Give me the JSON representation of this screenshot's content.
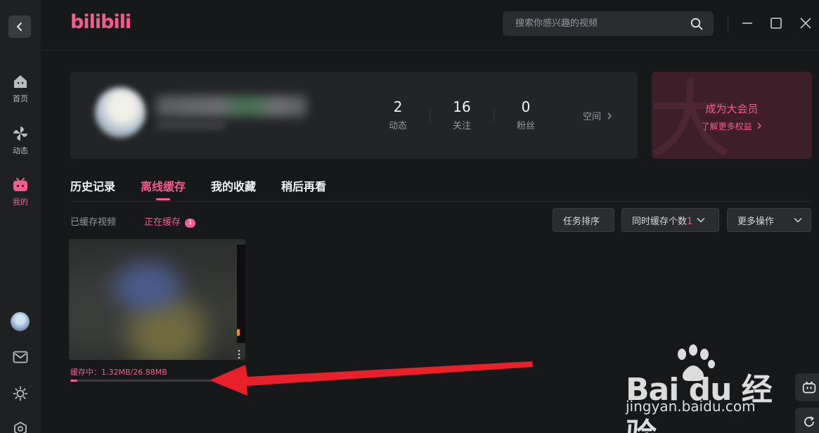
{
  "app": {
    "logo_text": "bilibili",
    "accent_color": "#f25d8e"
  },
  "search": {
    "placeholder": "搜索你感兴趣的视频"
  },
  "sidebar": {
    "items": [
      {
        "label": "首页",
        "icon": "home-icon"
      },
      {
        "label": "动态",
        "icon": "pinwheel-icon"
      },
      {
        "label": "我的",
        "icon": "tv-icon",
        "active": true
      }
    ],
    "bottom_icons": [
      "avatar",
      "mail-icon",
      "theme-sun-icon",
      "settings-icon"
    ]
  },
  "profile": {
    "stats": [
      {
        "value": "2",
        "label": "动态"
      },
      {
        "value": "16",
        "label": "关注"
      },
      {
        "value": "0",
        "label": "粉丝"
      }
    ],
    "space_link": "空间"
  },
  "vip": {
    "title": "成为大会员",
    "subtitle": "了解更多权益"
  },
  "tabs": [
    {
      "label": "历史记录"
    },
    {
      "label": "离线缓存",
      "active": true
    },
    {
      "label": "我的收藏"
    },
    {
      "label": "稍后再看"
    }
  ],
  "subtabs": {
    "cached": "已缓存视频",
    "caching": "正在缓存",
    "caching_badge": "1"
  },
  "actions": {
    "sort": "任务排序",
    "concurrent_label": "同时缓存个数",
    "concurrent_value": "1",
    "more": "更多操作"
  },
  "video": {
    "status": "缓存中：1.32MB/26.88MB",
    "progress": 0.049
  },
  "watermark": {
    "main": "Bai du 经验",
    "sub": "jingyan.baidu.com"
  }
}
